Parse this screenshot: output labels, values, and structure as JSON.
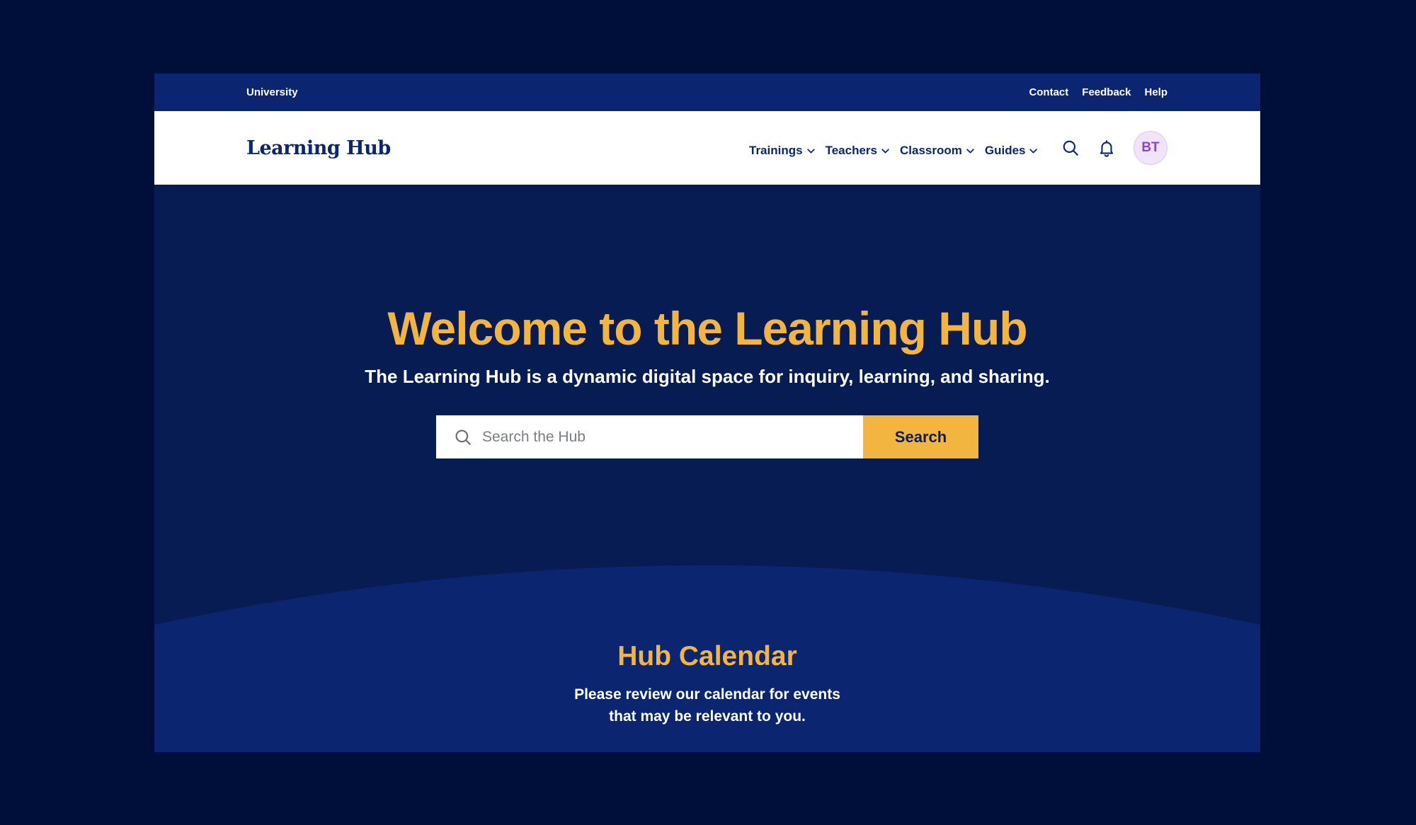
{
  "utility_bar": {
    "brand": "University",
    "links": [
      "Contact",
      "Feedback",
      "Help"
    ]
  },
  "header": {
    "logo": "Learning Hub",
    "nav": [
      "Trainings",
      "Teachers",
      "Classroom",
      "Guides"
    ],
    "avatar_initials": "BT"
  },
  "hero": {
    "title": "Welcome to the Learning Hub",
    "subtitle": "The Learning Hub is a dynamic digital space for inquiry, learning, and sharing.",
    "search_placeholder": "Search the Hub",
    "search_button": "Search"
  },
  "calendar": {
    "title": "Hub Calendar",
    "text_line1": "Please review our calendar for events",
    "text_line2": "that may be relevant to you."
  },
  "colors": {
    "page_bg": "#000f3a",
    "hero_bg": "#071c52",
    "bar_bg": "#0b2570",
    "accent": "#f2b540",
    "avatar_bg": "#f1e4fa",
    "avatar_text": "#8b45c8"
  },
  "icons": [
    "search-icon",
    "bell-icon",
    "chevron-down-icon"
  ]
}
